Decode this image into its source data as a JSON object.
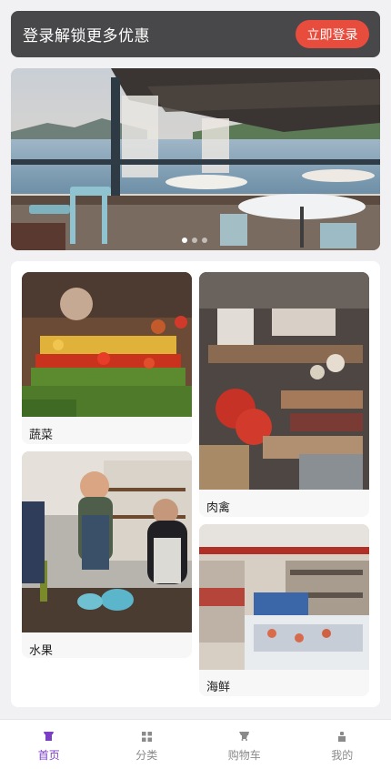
{
  "login_bar": {
    "text": "登录解锁更多优惠",
    "button": "立即登录"
  },
  "banner": {
    "slide_count": 3,
    "active_index": 0
  },
  "categories": [
    {
      "label": "蔬菜"
    },
    {
      "label": "肉禽"
    },
    {
      "label": "水果"
    },
    {
      "label": "海鲜"
    }
  ],
  "tabbar": [
    {
      "label": "首页",
      "icon": "home-icon",
      "active": true
    },
    {
      "label": "分类",
      "icon": "grid-icon",
      "active": false
    },
    {
      "label": "购物车",
      "icon": "cart-icon",
      "active": false
    },
    {
      "label": "我的",
      "icon": "user-icon",
      "active": false
    }
  ],
  "colors": {
    "accent": "#7b3fc7",
    "login_button": "#e84c3d",
    "login_bar": "#48484a"
  }
}
